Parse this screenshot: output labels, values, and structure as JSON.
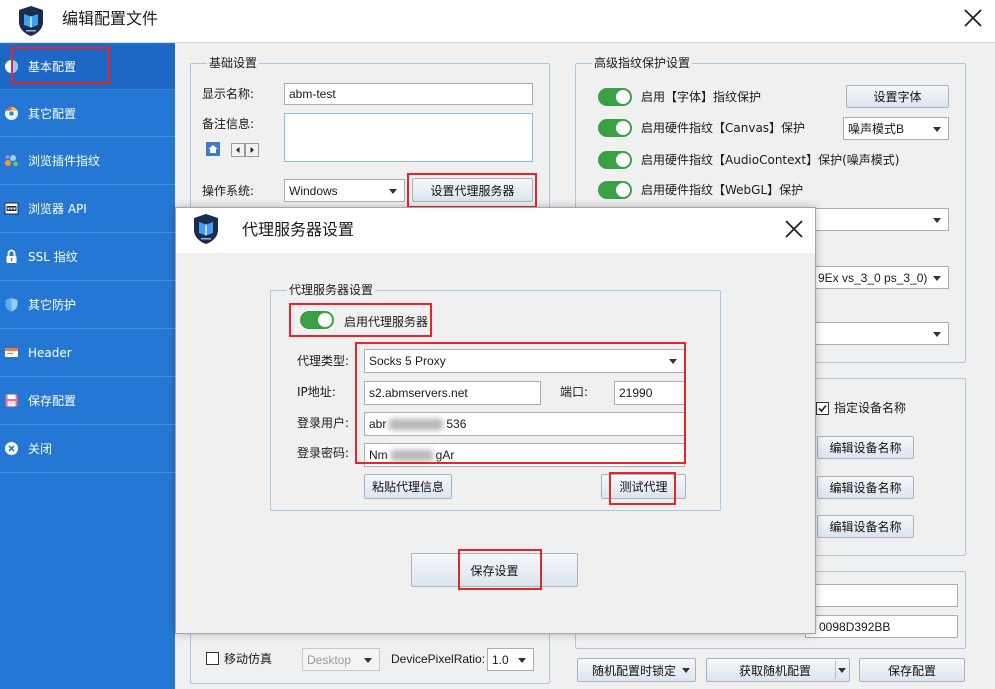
{
  "colors": {
    "sidebar": "#2478d4",
    "sidebar_selected": "#1c68c4",
    "toggle_on": "#3a9f45",
    "highlight": "#e4262b"
  },
  "window": {
    "title": "编辑配置文件"
  },
  "sidebar": {
    "items": [
      {
        "label": "基本配置",
        "icon": "info-icon",
        "selected": true
      },
      {
        "label": "其它配置",
        "icon": "browser-icon"
      },
      {
        "label": "浏览插件指纹",
        "icon": "plugin-icon"
      },
      {
        "label": "浏览器 API",
        "icon": "api-icon"
      },
      {
        "label": "SSL 指纹",
        "icon": "lock-icon"
      },
      {
        "label": "其它防护",
        "icon": "shield-icon"
      },
      {
        "label": "Header",
        "icon": "header-icon"
      },
      {
        "label": "保存配置",
        "icon": "floppy-icon"
      },
      {
        "label": "关闭",
        "icon": "close-circle-icon"
      }
    ]
  },
  "basic": {
    "legend": "基础设置",
    "display_name_label": "显示名称:",
    "display_name_value": "abm-test",
    "note_label": "备注信息:",
    "os_label": "操作系统:",
    "os_value": "Windows",
    "proxy_button": "设置代理服务器",
    "mobile_label": "移动仿真",
    "mobile_checked": false,
    "device_value": "Desktop",
    "dpr_label": "DevicePixelRatio:",
    "dpr_value": "1.0"
  },
  "advanced": {
    "legend": "高级指纹保护设置",
    "toggles": [
      {
        "label": "启用【字体】指纹保护",
        "on": true
      },
      {
        "label": "启用硬件指纹【Canvas】保护",
        "on": true
      },
      {
        "label": "启用硬件指纹【AudioContext】保护(噪声模式)",
        "on": true
      },
      {
        "label": "启用硬件指纹【WebGL】保护",
        "on": true
      }
    ],
    "font_button": "设置字体",
    "canvas_mode": "噪声模式B",
    "select_2_value": "9Ex vs_3_0 ps_3_0)"
  },
  "device": {
    "checkbox_label": "指定设备名称",
    "checked": true,
    "edit_buttons": [
      "编辑设备名称",
      "编辑设备名称",
      "编辑设备名称"
    ]
  },
  "identifiers": {
    "input_2_value": "0098D392BB"
  },
  "footer": {
    "lock_button": "随机配置时锁定",
    "random_button": "获取随机配置",
    "save_button": "保存配置"
  },
  "dialog": {
    "title": "代理服务器设置",
    "legend": "代理服务器设置",
    "enable_label": "启用代理服务器",
    "enabled": true,
    "type_label": "代理类型:",
    "type_value": "Socks 5 Proxy",
    "ip_label": "IP地址:",
    "ip_value": "s2.abmservers.net",
    "port_label": "端口:",
    "port_value": "21990",
    "user_label": "登录用户:",
    "user_visible_start": "abr",
    "user_visible_end": "536",
    "pass_label": "登录密码:",
    "pass_visible_start": "Nm",
    "pass_visible_end": "gAr",
    "paste_button": "粘贴代理信息",
    "test_button": "测试代理",
    "save_button": "保存设置"
  }
}
